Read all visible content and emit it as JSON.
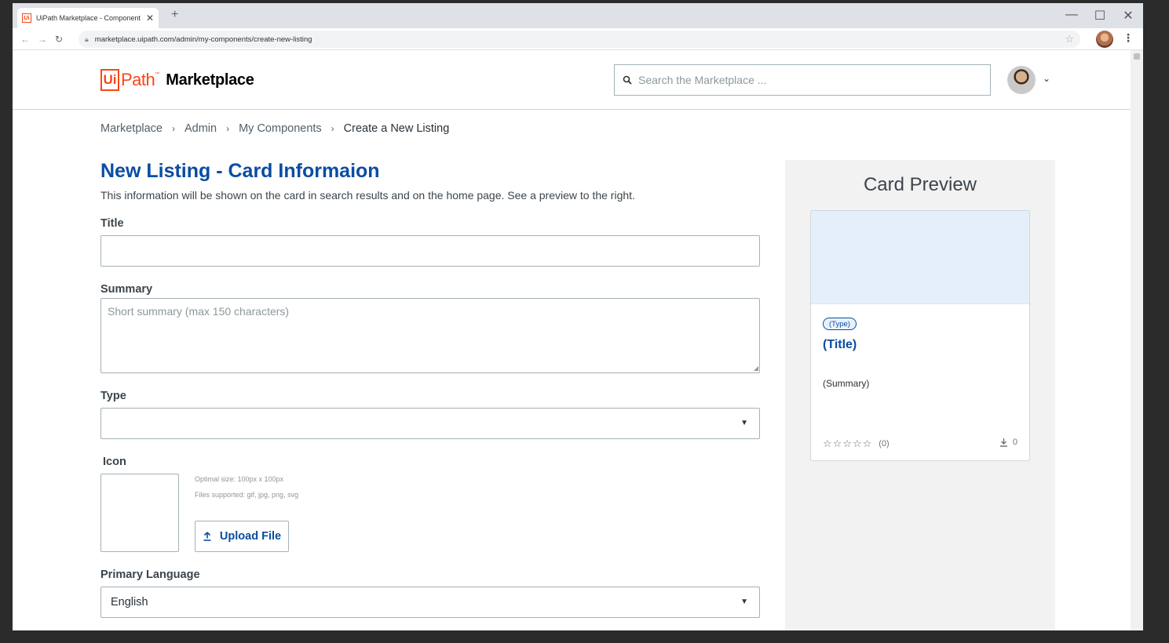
{
  "browser": {
    "tab_title": "UiPath Marketplace - Component",
    "favicon_text": "Ui",
    "close_glyph": "✕",
    "new_tab_glyph": "+",
    "url": "marketplace.uipath.com/admin/my-components/create-new-listing",
    "back_glyph": "←",
    "forward_glyph": "→",
    "reload_glyph": "↻",
    "star_glyph": "☆",
    "kebab_glyph": "⋮",
    "minimize_glyph": "—",
    "maximize_glyph": "☐",
    "window_close_glyph": "✕"
  },
  "header": {
    "logo_ui": "Ui",
    "logo_path": "Path",
    "logo_tm": "™",
    "logo_marketplace": "Marketplace",
    "search_placeholder": "Search the Marketplace ...",
    "search_icon": "search-icon",
    "chevron": "⌄"
  },
  "breadcrumb": {
    "items": [
      "Marketplace",
      "Admin",
      "My Components"
    ],
    "current": "Create a New Listing",
    "separator": "›"
  },
  "form": {
    "title": "New Listing - Card Informaion",
    "description": "This information will be shown on the card in search results and on the home page.  See a preview to the right.",
    "title_label": "Title",
    "title_value": "",
    "summary_label": "Summary",
    "summary_placeholder": "Short summary (max 150 characters)",
    "type_label": "Type",
    "type_value": "",
    "icon_label": "Icon",
    "icon_hint_size": "Optimal size:  100px x 100px",
    "icon_hint_files": "Files supported: gif, jpg, png, svg",
    "upload_label": "Upload File",
    "language_label": "Primary Language",
    "language_value": "English",
    "caret_glyph": "▼"
  },
  "preview": {
    "heading": "Card Preview",
    "type_badge": "(Type)",
    "title": "(Title)",
    "summary": "(Summary)",
    "stars": "☆☆☆☆☆",
    "star_count": 5,
    "rating_count": "(0)",
    "downloads": "0"
  },
  "colors": {
    "brand_orange": "#fa4616",
    "link_blue": "#0a4da2",
    "card_image_bg": "#e5eff9",
    "preview_panel_bg": "#f2f2f3"
  }
}
